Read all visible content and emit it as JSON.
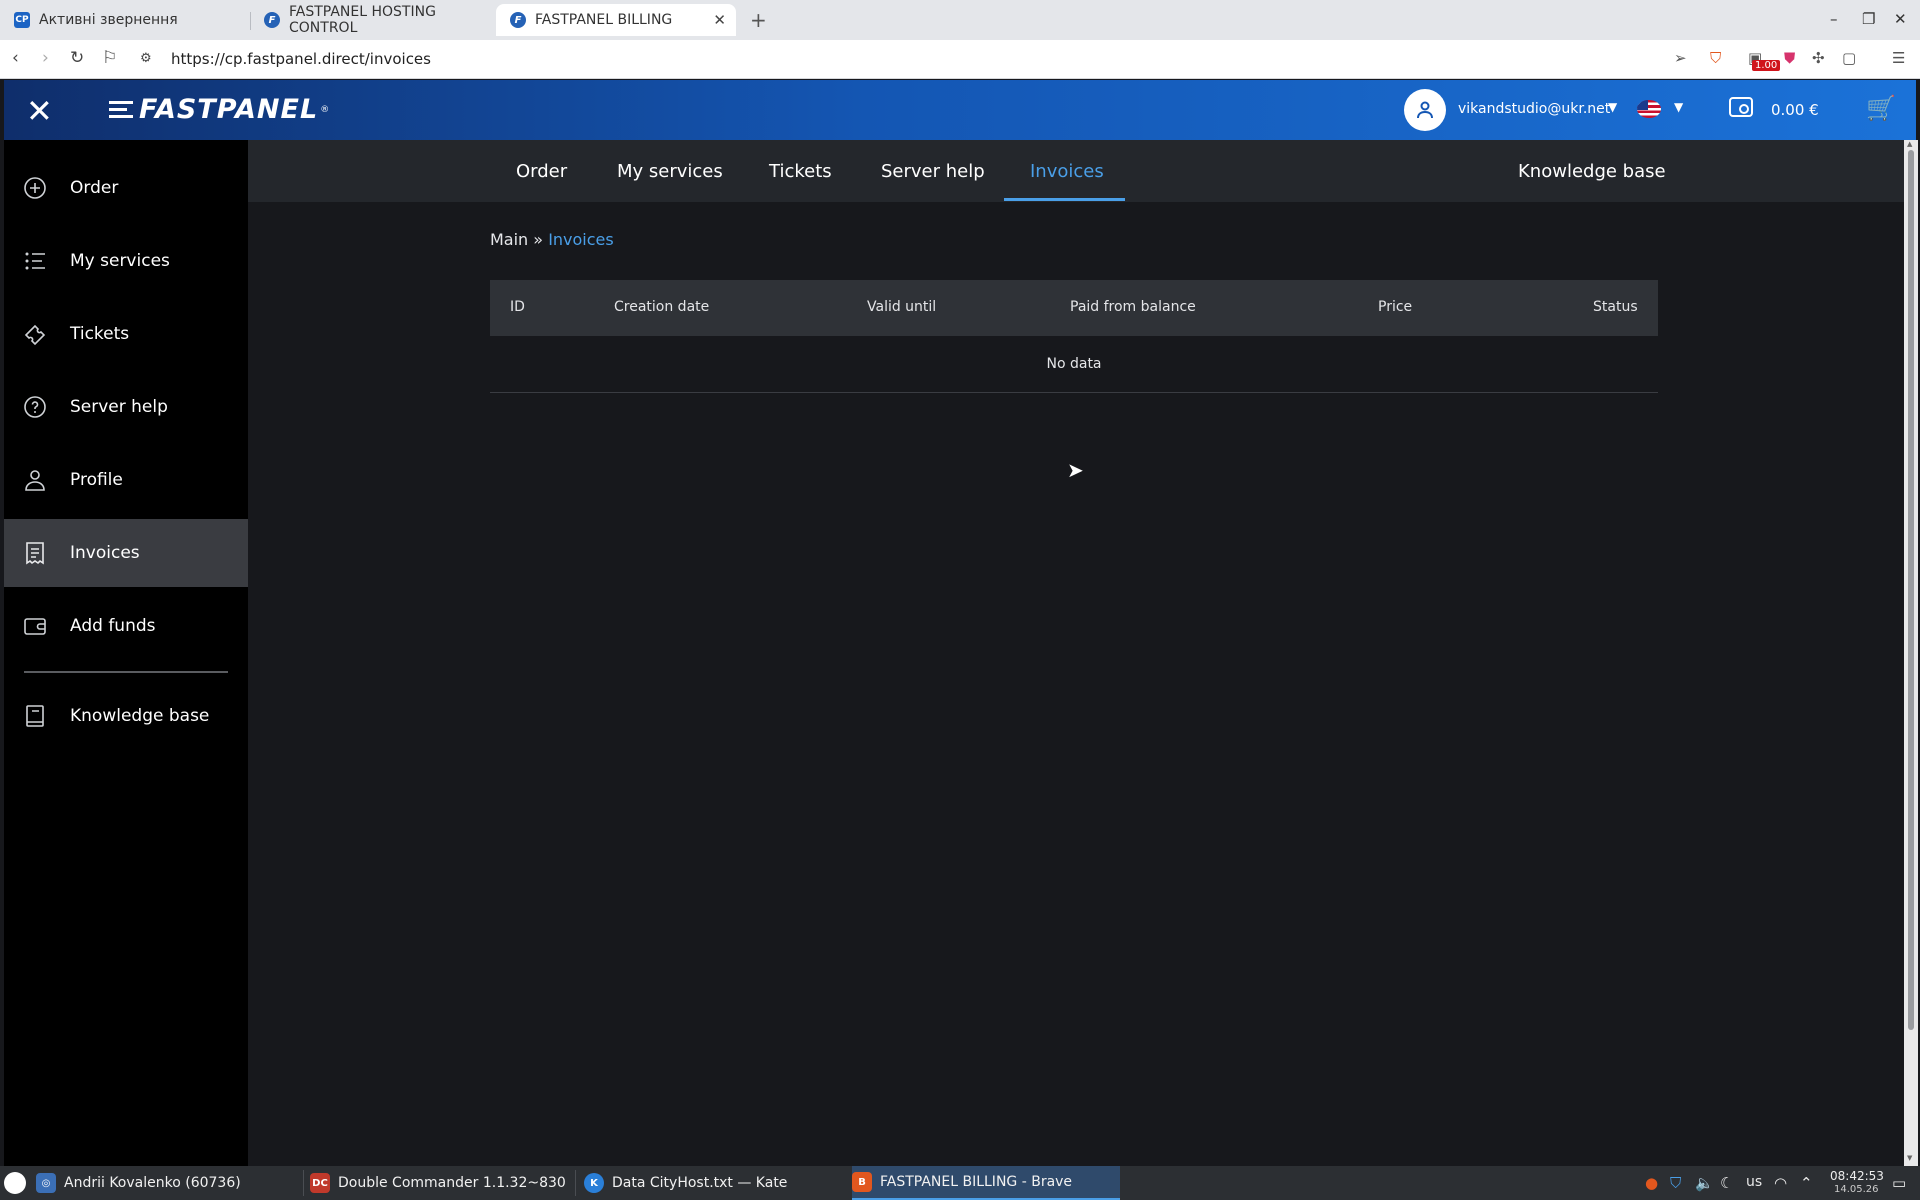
{
  "browser": {
    "tabs": [
      {
        "label": "Активні звернення",
        "favicon": "CP"
      },
      {
        "label": "FASTPANEL HOSTING CONTROL",
        "favicon": "F"
      },
      {
        "label": "FASTPANEL BILLING",
        "favicon": "F"
      }
    ],
    "url": "https://cp.fastpanel.direct/invoices",
    "extension_badge": "1.00"
  },
  "header": {
    "logo_text": "FASTPANEL",
    "logo_reg": "®",
    "user_email": "vikandstudio@ukr.net",
    "balance": "0.00 €",
    "language": "en-US"
  },
  "sidebar": {
    "items": [
      {
        "label": "Order",
        "icon": "plus-circle-icon"
      },
      {
        "label": "My services",
        "icon": "list-icon"
      },
      {
        "label": "Tickets",
        "icon": "ticket-icon"
      },
      {
        "label": "Server help",
        "icon": "help-circle-icon"
      },
      {
        "label": "Profile",
        "icon": "user-icon"
      },
      {
        "label": "Invoices",
        "icon": "receipt-icon"
      },
      {
        "label": "Add funds",
        "icon": "wallet-icon"
      },
      {
        "label": "Knowledge base",
        "icon": "book-icon"
      }
    ],
    "active": "Invoices"
  },
  "topnav": {
    "tabs": [
      "Order",
      "My services",
      "Tickets",
      "Server help",
      "Invoices"
    ],
    "active": "Invoices",
    "right_link": "Knowledge base"
  },
  "breadcrumb": {
    "root": "Main",
    "separator": "»",
    "current": "Invoices"
  },
  "table": {
    "columns": [
      "ID",
      "Creation date",
      "Valid until",
      "Paid from balance",
      "Price",
      "Status"
    ],
    "rows": [],
    "empty_text": "No data"
  },
  "taskbar": {
    "items": [
      {
        "label": "Andrii Kovalenko (60736)"
      },
      {
        "label": "Double Commander 1.1.32~830"
      },
      {
        "label": "Data CityHost.txt — Kate"
      },
      {
        "label": "FASTPANEL BILLING - Brave"
      }
    ],
    "keyboard_layout": "us",
    "time": "08:42:53",
    "date": "14.05.26"
  },
  "colors": {
    "accent": "#4a9fe8",
    "header_gradient_start": "#0f2e6b",
    "header_gradient_end": "#1b72d8",
    "sidebar_bg": "#000000",
    "main_bg": "#17181c"
  }
}
